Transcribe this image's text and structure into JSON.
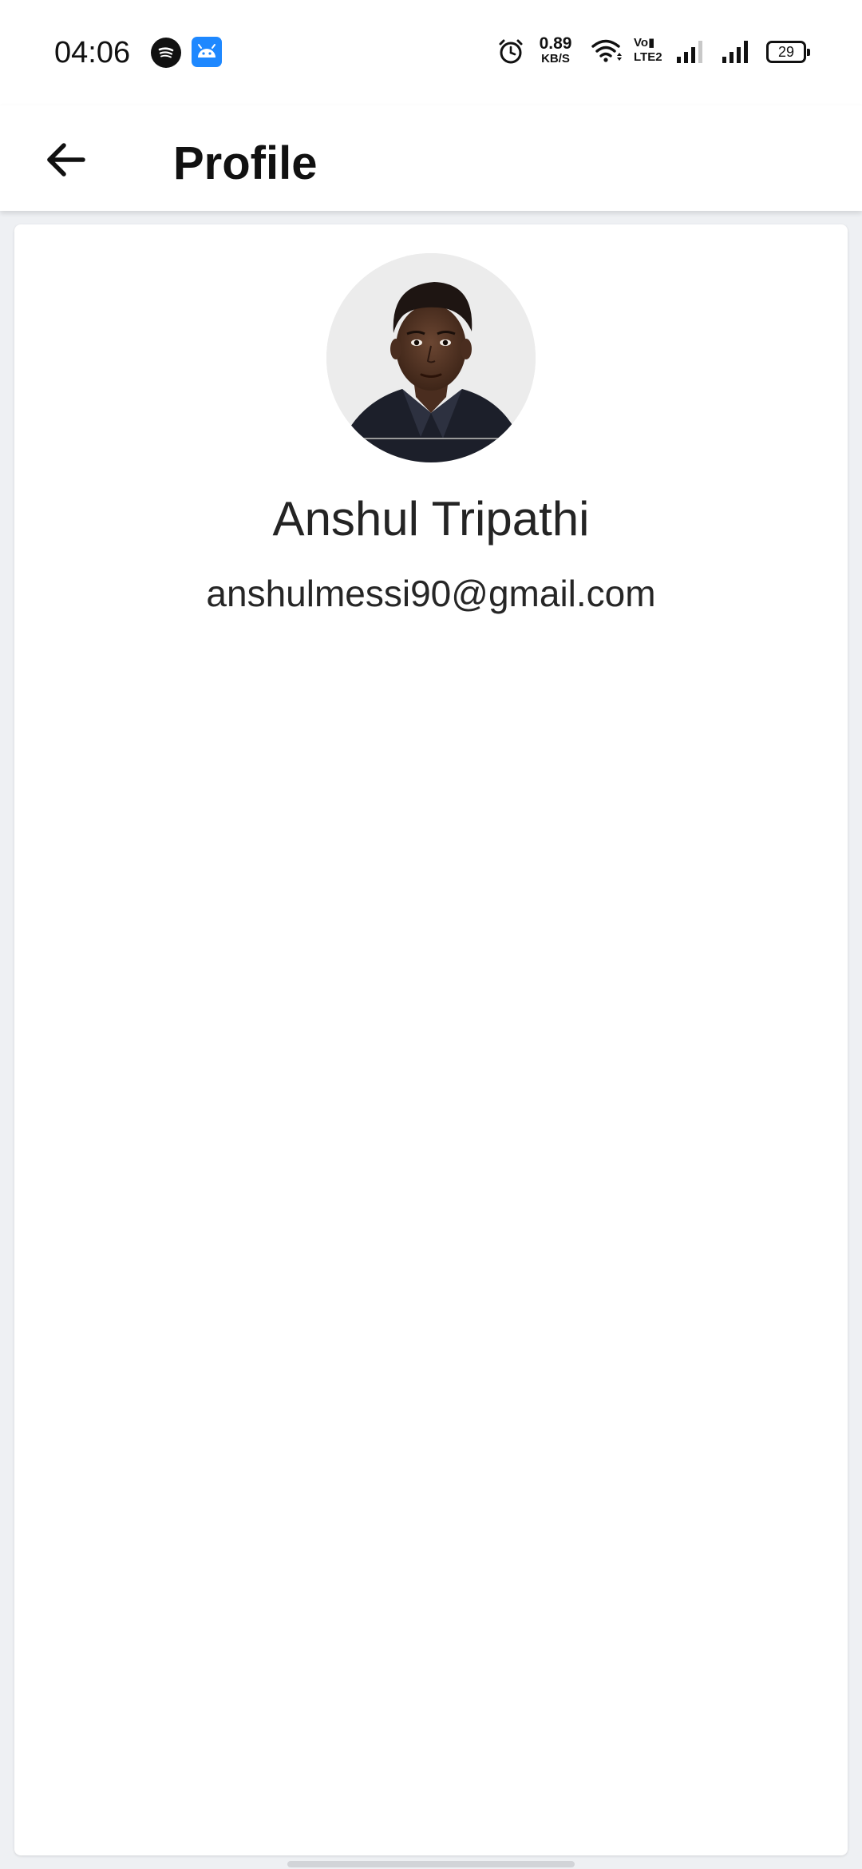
{
  "status_bar": {
    "time": "04:06",
    "net_speed_value": "0.89",
    "net_speed_unit": "KB/S",
    "volte_top": "Vo▮",
    "volte_bottom": "LTE2",
    "battery_level": "29",
    "icons": [
      "spotify-icon",
      "android-icon",
      "alarm-icon",
      "wifi-icon",
      "volte-icon",
      "signal-icon",
      "signal-icon",
      "battery-icon"
    ]
  },
  "app_bar": {
    "title": "Profile",
    "back_icon": "arrow-left-icon"
  },
  "profile": {
    "name": "Anshul Tripathi",
    "email": "anshulmessi90@gmail.com",
    "avatar": "profile-photo"
  },
  "colors": {
    "background": "#eef0f3",
    "surface": "#ffffff",
    "text_primary": "#111111",
    "android_icon": "#1e88ff"
  }
}
